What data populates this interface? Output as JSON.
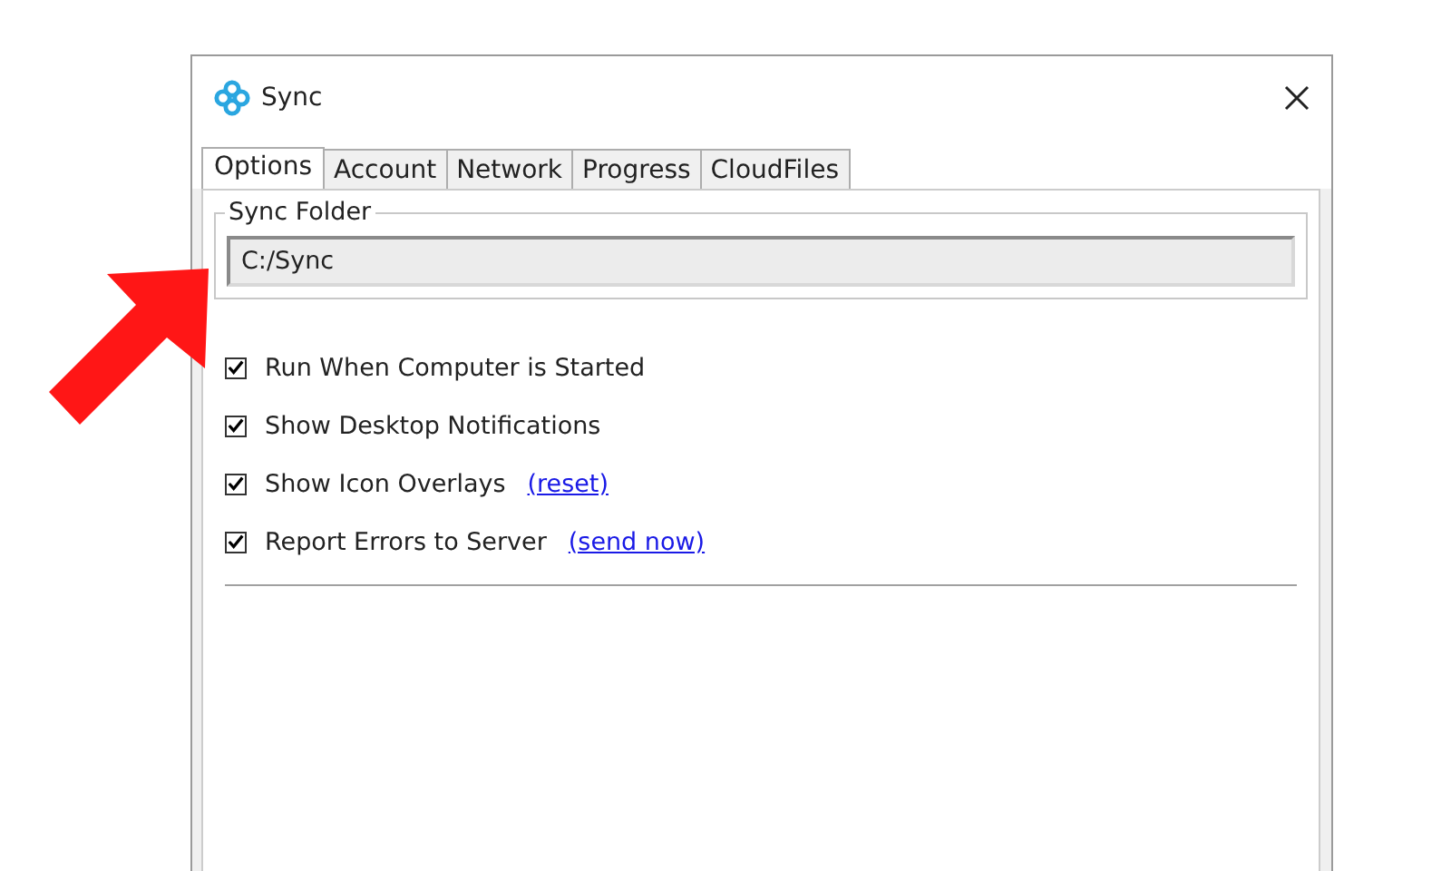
{
  "window": {
    "title": "Sync"
  },
  "tabs": [
    {
      "label": "Options",
      "selected": true
    },
    {
      "label": "Account",
      "selected": false
    },
    {
      "label": "Network",
      "selected": false
    },
    {
      "label": "Progress",
      "selected": false
    },
    {
      "label": "CloudFiles",
      "selected": false
    }
  ],
  "sync_folder": {
    "label": "Sync Folder",
    "value": "C:/Sync"
  },
  "options": [
    {
      "label": "Run When Computer is Started",
      "checked": true
    },
    {
      "label": "Show Desktop Notifications",
      "checked": true
    },
    {
      "label": "Show Icon Overlays",
      "checked": true,
      "link": "(reset)"
    },
    {
      "label": "Report Errors to Server",
      "checked": true,
      "link": "(send now)"
    }
  ]
}
